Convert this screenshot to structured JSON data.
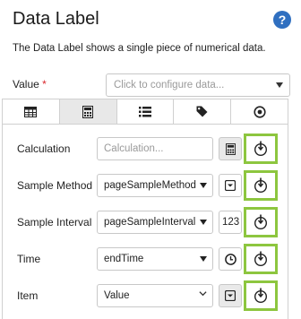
{
  "header": {
    "title": "Data Label",
    "help_icon": "help-circle-icon",
    "help_glyph": "?",
    "description": "The Data Label shows a single piece of numerical data."
  },
  "value_field": {
    "label": "Value",
    "required_marker": "*",
    "placeholder": "Click to configure data..."
  },
  "tabs": [
    {
      "icon": "table-icon",
      "active": false
    },
    {
      "icon": "calculator-icon",
      "active": true
    },
    {
      "icon": "list-icon",
      "active": false
    },
    {
      "icon": "tag-icon",
      "active": false
    },
    {
      "icon": "target-icon",
      "active": false
    }
  ],
  "rows": [
    {
      "label": "Calculation",
      "value": "Calculation...",
      "is_placeholder": true,
      "side_button_icon": "calculator-icon",
      "bind_icon": "data-bind-icon"
    },
    {
      "label": "Sample Method",
      "value": "pageSampleMethod",
      "is_placeholder": false,
      "side_button_icon": "dropdown-box-icon",
      "bind_icon": "data-bind-icon"
    },
    {
      "label": "Sample Interval",
      "value": "pageSampleInterval",
      "is_placeholder": false,
      "side_text": "123",
      "bind_icon": "data-bind-icon"
    },
    {
      "label": "Time",
      "value": "endTime",
      "is_placeholder": false,
      "side_button_icon": "clock-icon",
      "bind_icon": "data-bind-icon"
    },
    {
      "label": "Item",
      "value": "Value",
      "is_placeholder": false,
      "side_button_icon": "dropdown-box-icon",
      "bind_icon": "data-bind-icon"
    }
  ],
  "colors": {
    "highlight": "#8dc63f",
    "help_blue": "#2f6fc0",
    "required_red": "#d9262b"
  }
}
